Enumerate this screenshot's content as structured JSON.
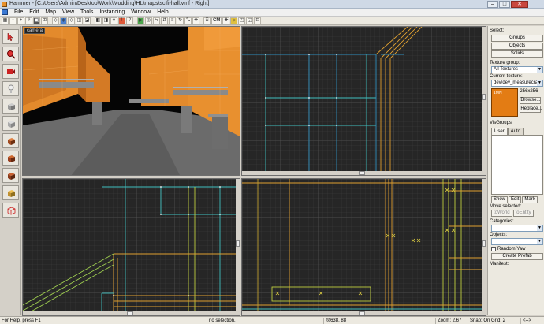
{
  "window": {
    "title": "Hammer - [C:\\Users\\Admin\\Desktop\\Work\\Modding\\HL\\maps\\scifi-hall.vmf - Right]",
    "minimize": "–",
    "maximize": "□",
    "close": "✕"
  },
  "menu": [
    "File",
    "Edit",
    "Map",
    "View",
    "Tools",
    "Instancing",
    "Window",
    "Help"
  ],
  "toolbar": {
    "cordon_label": "CM"
  },
  "viewports": {
    "camera_label": "camera"
  },
  "right_panel": {
    "select_label": "Select:",
    "groups_button": "Groups",
    "objects_button": "Objects",
    "solids_button": "Solids",
    "texture_group_label": "Texture group:",
    "texture_group_value": "All Textures",
    "current_texture_label": "Current texture:",
    "current_texture_value": "dev/dev_measurecrate",
    "texture_size": "256x256",
    "texture_thumb_label": "1MN",
    "browse_button": "Browse...",
    "replace_button": "Replace...",
    "visgroups_label": "VisGroups:",
    "tab_user": "User",
    "tab_auto": "Auto",
    "show_button": "Show",
    "edit_button": "Edit",
    "mark_button": "Mark",
    "move_selected_label": "Move selected:",
    "to_world_button": "toWorld",
    "to_entity_button": "toEntity",
    "categories_label": "Categories:",
    "objects_label": "Objects:",
    "random_yaw_label": "Random Yaw",
    "create_prefab_button": "Create Prefab",
    "manifest_label": "Manifest:"
  },
  "status": {
    "help": "For Help, press F1",
    "selection": "no selection.",
    "coords": "@638, 88",
    "zoom": "Zoom: 2.67",
    "snap": "Snap: On Grid: 2",
    "arrows": "<-->"
  },
  "colors": {
    "accent_orange": "#e37c14",
    "grid": "#3a3a3a",
    "viewport_bg": "#2a2a2a"
  }
}
